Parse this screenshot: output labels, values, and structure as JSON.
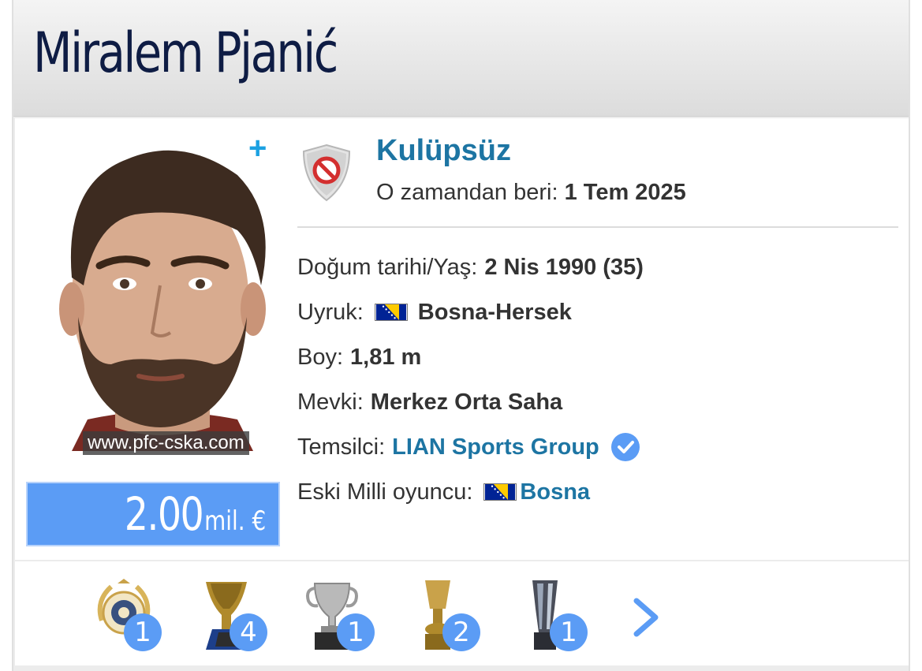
{
  "player": {
    "first_name": "Miralem",
    "last_name": "Pjanić",
    "photo_credit": "www.pfc-cska.com",
    "plus_label": "+"
  },
  "market_value": {
    "amount": "2.00",
    "unit": "mil. €"
  },
  "club": {
    "name": "Kulüpsüz",
    "since_label": "O zamandan beri:",
    "since_value": "1 Tem 2025",
    "shield_icon": "no-club-shield-icon"
  },
  "details": {
    "birth_label": "Doğum tarihi/Yaş:",
    "birth_value": "2 Nis 1990 (35)",
    "nationality_label": "Uyruk:",
    "nationality_value": "Bosna-Hersek",
    "height_label": "Boy:",
    "height_value": "1,81 m",
    "position_label": "Mevki:",
    "position_value": "Merkez Orta Saha",
    "agent_label": "Temsilci:",
    "agent_value": "LIAN Sports Group",
    "former_national_label": "Eski Milli oyuncu:",
    "former_national_value": "Bosna"
  },
  "trophies": [
    {
      "icon": "laurel-medal-icon",
      "count": "1"
    },
    {
      "icon": "gold-cup-icon",
      "count": "4"
    },
    {
      "icon": "silver-cup-icon",
      "count": "1"
    },
    {
      "icon": "coppa-italia-icon",
      "count": "2"
    },
    {
      "icon": "supercup-icon",
      "count": "1"
    }
  ],
  "colors": {
    "accent_blue": "#1d75a3",
    "badge_blue": "#5b9cf5",
    "title_navy": "#0e1c44",
    "plus_blue": "#1ba1e2"
  }
}
